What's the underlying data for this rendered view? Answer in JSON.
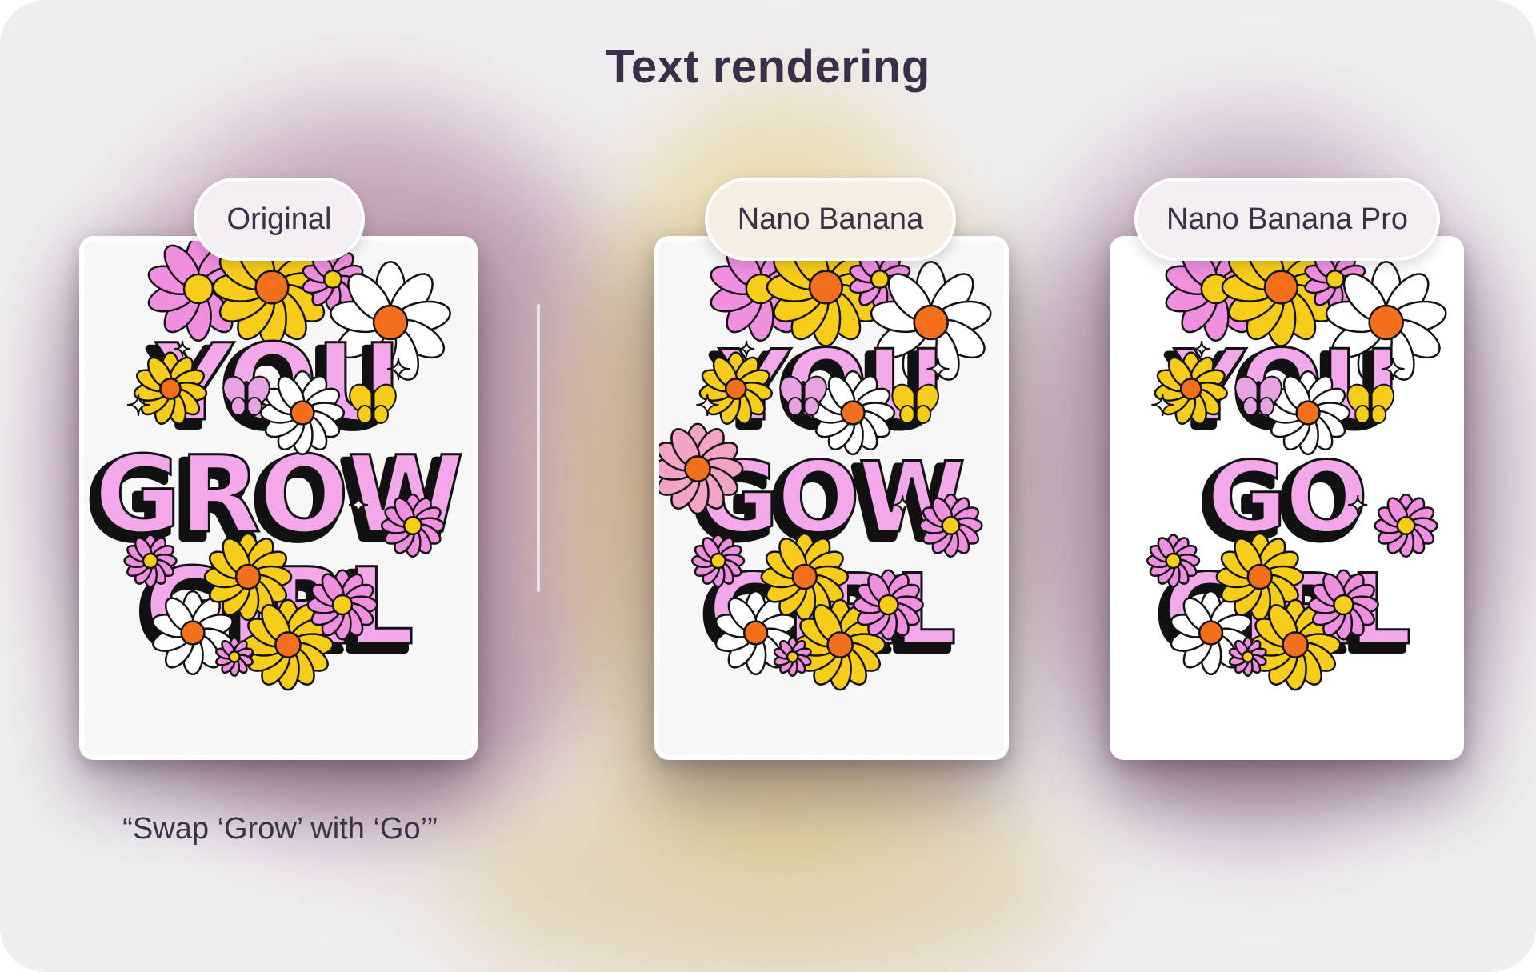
{
  "title": "Text rendering",
  "panels": [
    {
      "label": "Original",
      "poster_lines": [
        "YOU",
        "GROW",
        "GIRL"
      ]
    },
    {
      "label": "Nano Banana",
      "poster_lines": [
        "YOU",
        "GOW",
        "GIRL"
      ]
    },
    {
      "label": "Nano Banana Pro",
      "poster_lines": [
        "YOU",
        "GO",
        "GIRL"
      ]
    }
  ],
  "prompt": "“Swap ‘Grow’ with ‘Go’”",
  "colors": {
    "title": "#3a2f4a",
    "text": "#3a3348",
    "letter_pink": "#f3a8ec",
    "petal_yellow": "#f7cc1a",
    "petal_pink": "#f08fe0",
    "center_orange": "#f36f1c",
    "outline": "#111111"
  }
}
